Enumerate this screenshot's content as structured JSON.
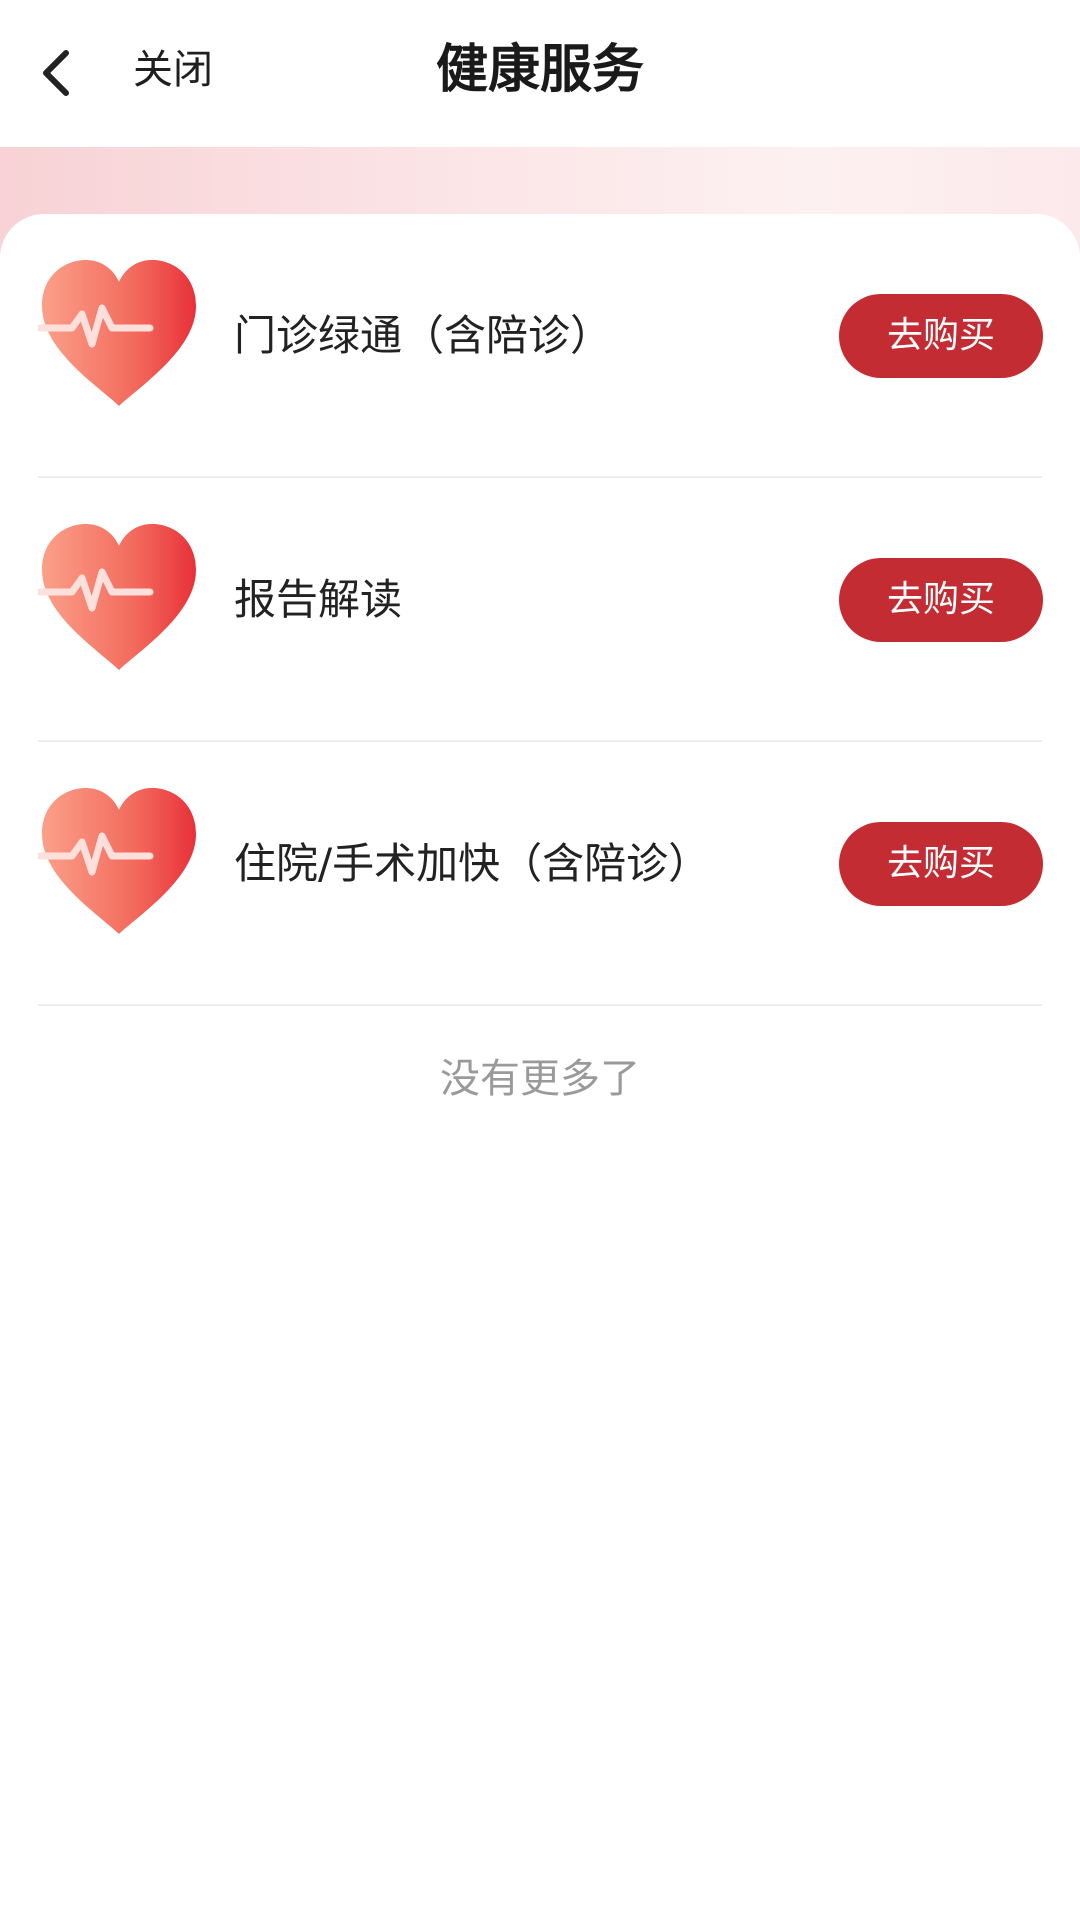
{
  "header": {
    "back_icon": "chevron-left-icon",
    "close_label": "关闭",
    "title": "健康服务"
  },
  "services": [
    {
      "name": "门诊绿通（含陪诊）",
      "button_label": "去购买",
      "icon": "heartbeat-heart-icon"
    },
    {
      "name": "报告解读",
      "button_label": "去购买",
      "icon": "heartbeat-heart-icon"
    },
    {
      "name": "住院/手术加快（含陪诊）",
      "button_label": "去购买",
      "icon": "heartbeat-heart-icon"
    }
  ],
  "footer": {
    "no_more_label": "没有更多了"
  },
  "colors": {
    "accent": "#c42c34",
    "title_text": "#1a1a1a",
    "muted_text": "#9a9a9a",
    "banner": "#f8d2d5"
  }
}
